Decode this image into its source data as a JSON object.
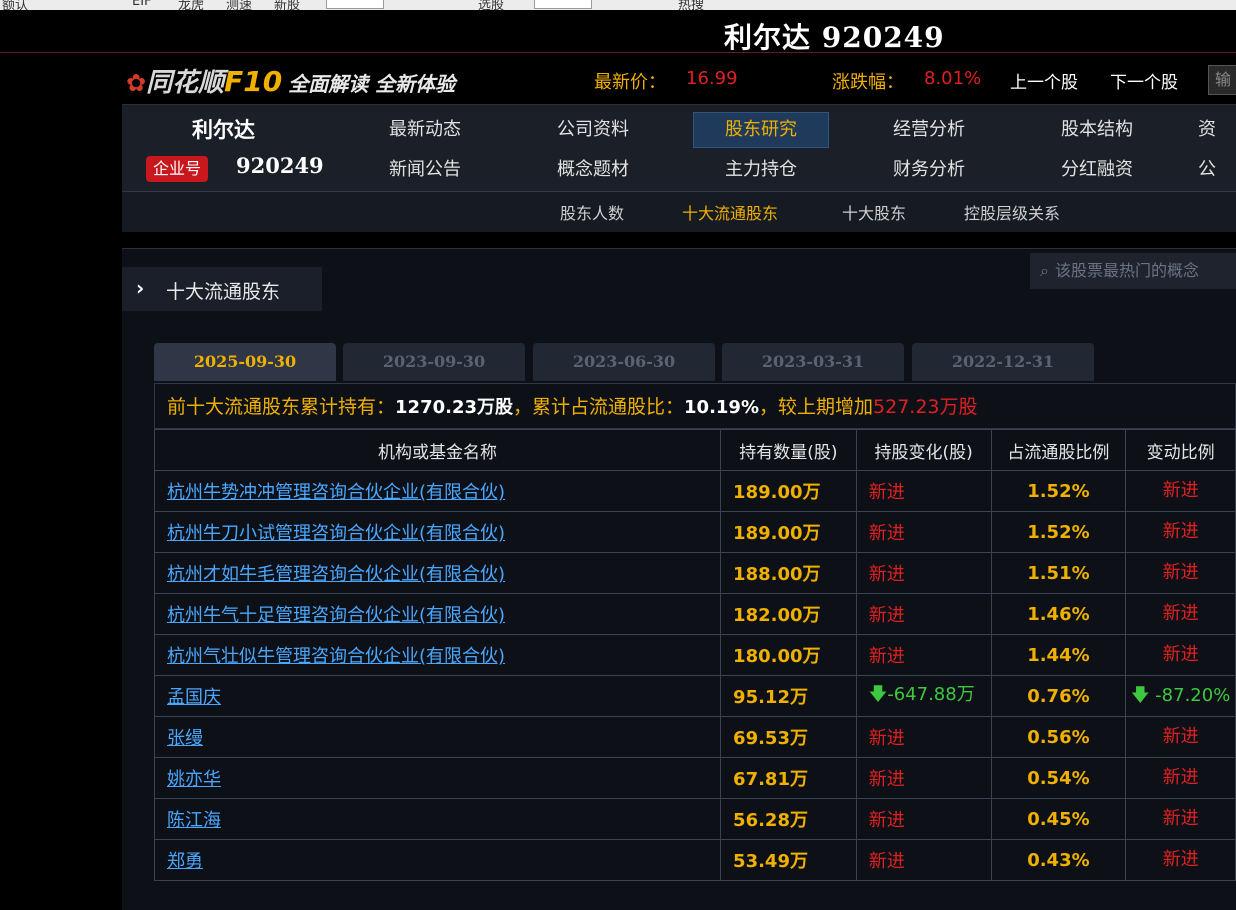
{
  "topstrip": {
    "items": [
      "额认",
      "EIF",
      "龙虎",
      "测速",
      "新股",
      "选股",
      "热搜"
    ]
  },
  "window": {
    "title": "利尔达 920249"
  },
  "header": {
    "logo_brand": "同花顺",
    "logo_f10": "F10",
    "logo_slogan": "全面解读 全新体验",
    "latest_price_label": "最新价：",
    "latest_price": "16.99",
    "change_label": "涨跌幅：",
    "change_pct": "8.01%",
    "prev_stock": "上一个股",
    "next_stock": "下一个股",
    "input_placeholder": "输"
  },
  "stock": {
    "name": "利尔达",
    "badge": "企业号",
    "code": "920249"
  },
  "nav": {
    "row1": [
      "最新动态",
      "公司资料",
      "股东研究",
      "经营分析",
      "股本结构",
      "资"
    ],
    "row2": [
      "新闻公告",
      "概念题材",
      "主力持仓",
      "财务分析",
      "分红融资",
      "公"
    ],
    "active": "股东研究",
    "sub": [
      "股东人数",
      "十大流通股东",
      "十大股东",
      "控股层级关系"
    ],
    "sub_active": "十大流通股东"
  },
  "section": {
    "title": "十大流通股东",
    "search_placeholder": "该股票最热门的概念"
  },
  "tabs": [
    "2025-09-30",
    "2023-09-30",
    "2023-06-30",
    "2023-03-31",
    "2022-12-31"
  ],
  "summary": {
    "p1": "前十大流通股东累计持有：",
    "v1": "1270.23万股",
    "p2": "，累计占流通股比：",
    "v2": "10.19%",
    "p3": "，较上期增加",
    "v3": "527.23万股"
  },
  "table": {
    "headers": [
      "机构或基金名称",
      "持有数量(股)",
      "持股变化(股)",
      "占流通股比例",
      "变动比例"
    ],
    "rows": [
      {
        "name": "杭州牛势冲冲管理咨询合伙企业(有限合伙)",
        "qty": "189.00万",
        "chg": "新进",
        "ratio": "1.52%",
        "rate": "新进"
      },
      {
        "name": "杭州牛刀小试管理咨询合伙企业(有限合伙)",
        "qty": "189.00万",
        "chg": "新进",
        "ratio": "1.52%",
        "rate": "新进"
      },
      {
        "name": "杭州才如牛毛管理咨询合伙企业(有限合伙)",
        "qty": "188.00万",
        "chg": "新进",
        "ratio": "1.51%",
        "rate": "新进"
      },
      {
        "name": "杭州牛气十足管理咨询合伙企业(有限合伙)",
        "qty": "182.00万",
        "chg": "新进",
        "ratio": "1.46%",
        "rate": "新进"
      },
      {
        "name": "杭州气壮似牛管理咨询合伙企业(有限合伙)",
        "qty": "180.00万",
        "chg": "新进",
        "ratio": "1.44%",
        "rate": "新进"
      },
      {
        "name": "孟国庆",
        "qty": "95.12万",
        "chg": "-647.88万",
        "ratio": "0.76%",
        "rate": "-87.20%"
      },
      {
        "name": "张缦",
        "qty": "69.53万",
        "chg": "新进",
        "ratio": "0.56%",
        "rate": "新进"
      },
      {
        "name": "姚亦华",
        "qty": "67.81万",
        "chg": "新进",
        "ratio": "0.54%",
        "rate": "新进"
      },
      {
        "name": "陈江海",
        "qty": "56.28万",
        "chg": "新进",
        "ratio": "0.45%",
        "rate": "新进"
      },
      {
        "name": "郑勇",
        "qty": "53.49万",
        "chg": "新进",
        "ratio": "0.43%",
        "rate": "新进"
      }
    ]
  },
  "colors": {
    "accent": "#f0b000",
    "up": "#e02020",
    "down": "#3ec83e",
    "link": "#4aa7ff"
  }
}
